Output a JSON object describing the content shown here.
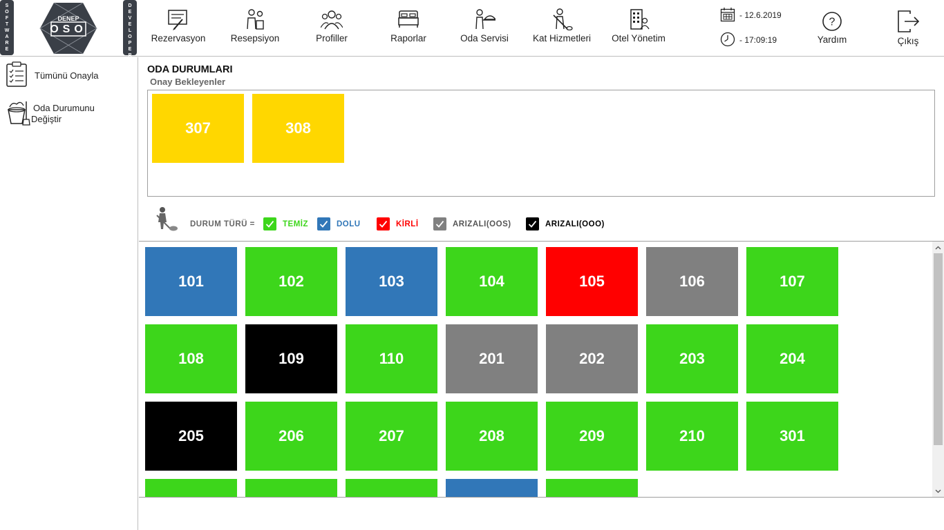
{
  "branding": {
    "left_band": [
      "S",
      "O",
      "F",
      "T",
      "W",
      "A",
      "R",
      "E"
    ],
    "right_band": [
      "D",
      "E",
      "V",
      "E",
      "L",
      "O",
      "P",
      "E",
      "R",
      "S"
    ],
    "logo_top": "DENEP",
    "logo_main": "OSO"
  },
  "nav": [
    {
      "id": "rezervasyon",
      "label": "Rezervasyon",
      "icon": "reservation-icon"
    },
    {
      "id": "resepsiyon",
      "label": "Resepsiyon",
      "icon": "reception-icon"
    },
    {
      "id": "profiller",
      "label": "Profiller",
      "icon": "profiles-icon"
    },
    {
      "id": "raporlar",
      "label": "Raporlar",
      "icon": "bed-report-icon"
    },
    {
      "id": "oda-servisi",
      "label": "Oda Servisi",
      "icon": "room-service-icon"
    },
    {
      "id": "kat-hizmetleri",
      "label": "Kat Hizmetleri",
      "icon": "housekeeping-icon"
    },
    {
      "id": "otel-yonetim",
      "label": "Otel Yönetim",
      "icon": "hotel-management-icon"
    }
  ],
  "datetime": {
    "date": "- 12.6.2019",
    "time": "- 17:09:19"
  },
  "help": {
    "label": "Yardım",
    "icon": "help-icon"
  },
  "exit": {
    "label": "Çıkış",
    "icon": "exit-icon"
  },
  "sidebar": [
    {
      "label": "Tümünü Onayla",
      "icon": "checklist-icon"
    },
    {
      "label": "Oda Durumunu Değiştir",
      "line1": "Oda Durumunu",
      "line2": "Değiştir",
      "icon": "cleaning-bucket-icon"
    }
  ],
  "main": {
    "title": "ODA DURUMLARI",
    "subtitle": "Onay Bekleyenler",
    "pending_rooms": [
      "307",
      "308"
    ],
    "pending_color": "#ffd700"
  },
  "legend": {
    "label": "DURUM TÜRÜ =",
    "items": [
      {
        "label": "TEMİZ",
        "color": "#3dd61b",
        "text_color": "#3dd61b"
      },
      {
        "label": "DOLU",
        "color": "#3177b8",
        "text_color": "#3177b8"
      },
      {
        "label": "KİRLİ",
        "color": "#ff0000",
        "text_color": "#ff0000"
      },
      {
        "label": "ARIZALI(OOS)",
        "color": "#808080",
        "text_color": "#555555"
      },
      {
        "label": "ARIZALI(OOO)",
        "color": "#000000",
        "text_color": "#000000"
      }
    ]
  },
  "status_colors": {
    "clean": "#3dd61b",
    "occupied": "#3177b8",
    "dirty": "#ff0000",
    "oos": "#808080",
    "ooo": "#000000"
  },
  "rooms": [
    {
      "number": "101",
      "status": "occupied"
    },
    {
      "number": "102",
      "status": "clean"
    },
    {
      "number": "103",
      "status": "occupied"
    },
    {
      "number": "104",
      "status": "clean"
    },
    {
      "number": "105",
      "status": "dirty"
    },
    {
      "number": "106",
      "status": "oos"
    },
    {
      "number": "107",
      "status": "clean"
    },
    {
      "number": "108",
      "status": "clean"
    },
    {
      "number": "109",
      "status": "ooo"
    },
    {
      "number": "110",
      "status": "clean"
    },
    {
      "number": "201",
      "status": "oos"
    },
    {
      "number": "202",
      "status": "oos"
    },
    {
      "number": "203",
      "status": "clean"
    },
    {
      "number": "204",
      "status": "clean"
    },
    {
      "number": "205",
      "status": "ooo"
    },
    {
      "number": "206",
      "status": "clean"
    },
    {
      "number": "207",
      "status": "clean"
    },
    {
      "number": "208",
      "status": "clean"
    },
    {
      "number": "209",
      "status": "clean"
    },
    {
      "number": "210",
      "status": "clean"
    },
    {
      "number": "301",
      "status": "clean"
    },
    {
      "number": "",
      "status": "clean"
    },
    {
      "number": "",
      "status": "clean"
    },
    {
      "number": "",
      "status": "clean"
    },
    {
      "number": "",
      "status": "occupied"
    },
    {
      "number": "",
      "status": "clean"
    }
  ]
}
